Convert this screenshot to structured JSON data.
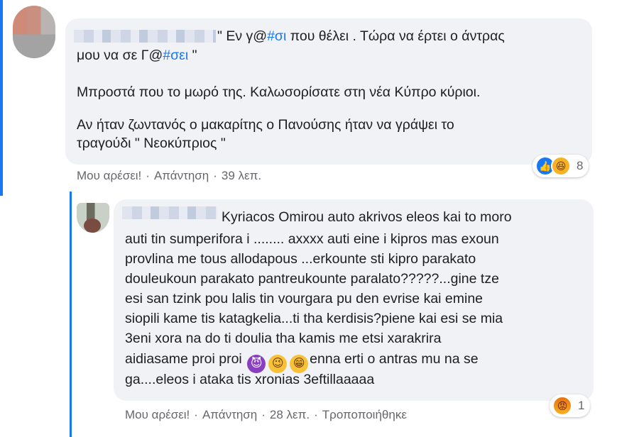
{
  "comments": [
    {
      "lines": [
        "\" Εν γ@",
        "#σι",
        " που θέλει . Τώρα να έρτει ο άντρας",
        "μου να σε Γ@",
        "#σει",
        " \"",
        "Μπροστά που το μωρό της. Καλωσορίσατε στη νέα Κύπρο κύριοι.",
        "Αν ήταν ζωντανός ο μακαρίτης ο Πανούσης ήταν να γράψει το",
        "τραγούδι \" Νεοκύπριος \""
      ],
      "actions": {
        "like": "Μου αρέσει!",
        "reply": "Απάντηση",
        "sep": "·",
        "time": "39 λεπ."
      },
      "reactions": {
        "icons": [
          "like-icon",
          "haha-icon"
        ],
        "count": "8"
      }
    },
    {
      "lines": [
        "Kyriacos Omirou auto akrivos eleos kai to moro",
        "auti tin sumperifora i ........ axxxx auti eine i kipros mas exoun",
        "provlina me tous allodapous ...erkounte sti kipro parakato",
        "douleukoun parakato pantreukounte paralato?????...gine tze",
        "esi san tzink pou lalis tin vourgara pu den evrise kai emine",
        "siopili kame tis katagkelia...ti tha kerdisis?piene kai esi se mia",
        "3eni xora na do ti doulia tha kamis me etsi xarakrira",
        "aidiasame proi proi ",
        "enna erti o antras mu na se",
        "ga....eleos i ataka tis xronias 3eftillaaaaa"
      ],
      "emojis": [
        "devil-icon",
        "wink-icon",
        "grin-icon"
      ],
      "actions": {
        "like": "Μου αρέσει!",
        "reply": "Απάντηση",
        "sep": "·",
        "time": "28 λεπ.",
        "edited": "Τροποποιήθηκε"
      },
      "reactions": {
        "icons": [
          "angry-icon"
        ],
        "count": "1"
      }
    }
  ],
  "colors": {
    "accent": "#1877f2",
    "bubble": "#f0f2f5",
    "meta": "#65676b"
  }
}
